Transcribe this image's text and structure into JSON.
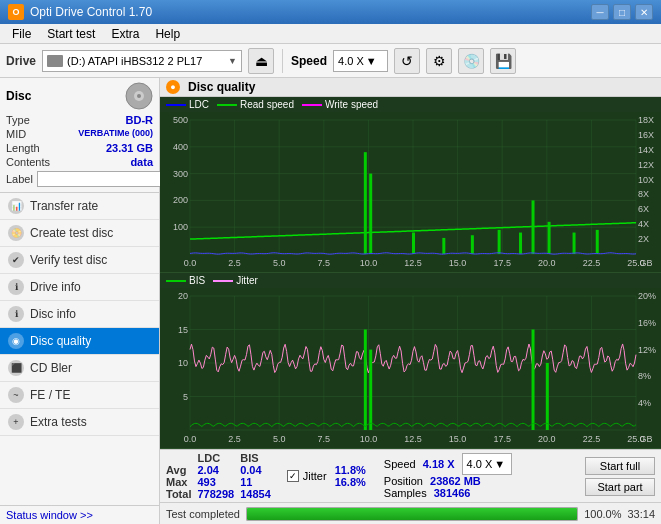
{
  "app": {
    "title": "Opti Drive Control 1.70",
    "icon": "O"
  },
  "titlebar": {
    "minimize": "─",
    "maximize": "□",
    "close": "✕"
  },
  "menu": {
    "items": [
      "File",
      "Start test",
      "Extra",
      "Help"
    ]
  },
  "toolbar": {
    "drive_label": "Drive",
    "drive_value": "(D:) ATAPI iHBS312  2 PL17",
    "speed_label": "Speed",
    "speed_value": "4.0 X"
  },
  "disc": {
    "title": "Disc",
    "type_label": "Type",
    "type_value": "BD-R",
    "mid_label": "MID",
    "mid_value": "VERBATIMe (000)",
    "length_label": "Length",
    "length_value": "23.31 GB",
    "contents_label": "Contents",
    "contents_value": "data",
    "label_label": "Label",
    "label_value": ""
  },
  "nav": {
    "items": [
      {
        "id": "transfer-rate",
        "label": "Transfer rate",
        "active": false
      },
      {
        "id": "create-test-disc",
        "label": "Create test disc",
        "active": false
      },
      {
        "id": "verify-test-disc",
        "label": "Verify test disc",
        "active": false
      },
      {
        "id": "drive-info",
        "label": "Drive info",
        "active": false
      },
      {
        "id": "disc-info",
        "label": "Disc info",
        "active": false
      },
      {
        "id": "disc-quality",
        "label": "Disc quality",
        "active": true
      },
      {
        "id": "cd-bler",
        "label": "CD Bler",
        "active": false
      },
      {
        "id": "fe-te",
        "label": "FE / TE",
        "active": false
      },
      {
        "id": "extra-tests",
        "label": "Extra tests",
        "active": false
      }
    ]
  },
  "status_window_btn": "Status window >>",
  "chart": {
    "title": "Disc quality",
    "legend1": {
      "ldc_label": "LDC",
      "read_label": "Read speed",
      "write_label": "Write speed"
    },
    "legend2": {
      "bis_label": "BIS",
      "jitter_label": "Jitter"
    },
    "top": {
      "y_max": 500,
      "y_right_max": 18,
      "x_max": 25,
      "x_label": "GB"
    },
    "bottom": {
      "y_max": 20,
      "y_right_max": 20,
      "x_max": 25,
      "x_label": "GB"
    }
  },
  "stats": {
    "headers": [
      "",
      "LDC",
      "BIS"
    ],
    "avg_label": "Avg",
    "avg_ldc": "2.04",
    "avg_bis": "0.04",
    "max_label": "Max",
    "max_ldc": "493",
    "max_bis": "11",
    "total_label": "Total",
    "total_ldc": "778298",
    "total_bis": "14854",
    "jitter_label": "Jitter",
    "jitter_avg": "11.8%",
    "jitter_max": "16.8%",
    "speed_label": "Speed",
    "speed_value": "4.18 X",
    "speed_select": "4.0 X",
    "position_label": "Position",
    "position_value": "23862 MB",
    "samples_label": "Samples",
    "samples_value": "381466",
    "start_full_label": "Start full",
    "start_part_label": "Start part"
  },
  "progress": {
    "status_text": "Test completed",
    "percent": 100,
    "percent_label": "100.0%",
    "time": "33:14"
  }
}
